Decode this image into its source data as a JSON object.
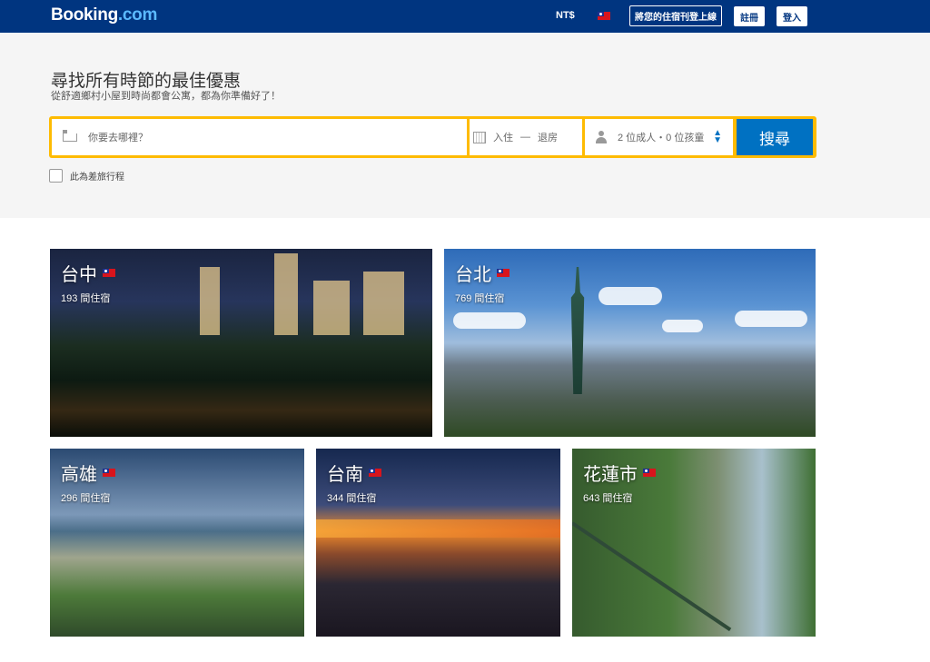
{
  "header": {
    "logo_main": "Booking",
    "logo_dot": ".com",
    "currency": "NT$",
    "language_flag_icon": "taiwan-flag-icon",
    "list_property": "將您的住宿刊登上線",
    "register": "註冊",
    "sign_in": "登入"
  },
  "hero": {
    "title": "尋找所有時節的最佳優惠",
    "subtitle": "從舒適鄉村小屋到時尚都會公寓，都為你準備好了！"
  },
  "search": {
    "destination_placeholder": "你要去哪裡？",
    "checkin": "入住",
    "dash": "—",
    "checkout": "退房",
    "guests": "2 位成人・0 位孩童",
    "button": "搜尋",
    "business_trip": "此為差旅行程"
  },
  "destinations": [
    {
      "name": "台中",
      "count": "193 間住宿"
    },
    {
      "name": "台北",
      "count": "769 間住宿"
    },
    {
      "name": "高雄",
      "count": "296 間住宿"
    },
    {
      "name": "台南",
      "count": "344 間住宿"
    },
    {
      "name": "花蓮市",
      "count": "643 間住宿"
    }
  ],
  "colors": {
    "brand_blue": "#003580",
    "accent_yellow": "#febb02",
    "button_blue": "#0071c2"
  }
}
